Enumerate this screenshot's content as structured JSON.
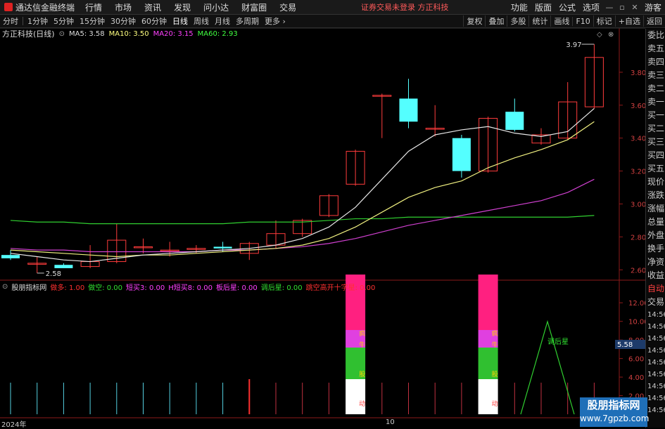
{
  "menu": {
    "app_title": "通达信金融终端",
    "items": [
      "行情",
      "市场",
      "资讯",
      "发现",
      "问小达",
      "财富圈",
      "交易"
    ],
    "notice": "证券交易未登录  方正科技",
    "right_items": [
      "功能",
      "版面",
      "公式",
      "选项"
    ],
    "guest": "游客"
  },
  "periods": [
    "分时",
    "1分钟",
    "5分钟",
    "15分钟",
    "30分钟",
    "60分钟",
    "日线",
    "周线",
    "月线",
    "多周期",
    "更多"
  ],
  "active_period": "日线",
  "toolbar": [
    "复权",
    "叠加",
    "多股",
    "统计",
    "画线",
    "F10",
    "标记",
    "+自选",
    "返回"
  ],
  "stock": {
    "name": "方正科技(日线)",
    "ma5": "MA5: 3.58",
    "ma10": "MA10: 3.50",
    "ma20": "MA20: 3.15",
    "ma60": "MA60: 2.93"
  },
  "price_axis": [
    "3.80",
    "3.60",
    "3.40",
    "3.20",
    "3.00",
    "2.80",
    "2.60"
  ],
  "price_labels": {
    "high": "3.97",
    "low": "2.58"
  },
  "indicator": {
    "name": "股朋指标网",
    "items": [
      {
        "label": "做多: 1.00",
        "color": "#ff3030"
      },
      {
        "label": "做空: 0.00",
        "color": "#30e030"
      },
      {
        "label": "短买3: 0.00",
        "color": "#ff40ff"
      },
      {
        "label": "H短买8: 0.00",
        "color": "#ff40ff"
      },
      {
        "label": "板后星: 0.00",
        "color": "#ff40ff"
      },
      {
        "label": "调后星: 0.00",
        "color": "#30e030"
      },
      {
        "label": "跳空高开十字星: 0.00",
        "color": "#ff3030"
      }
    ],
    "axis": [
      "12.00",
      "10.00",
      "8.00",
      "6.00",
      "4.00",
      "2.00"
    ],
    "cursor_value": "5.58",
    "bar_labels": [
      "疯",
      "牛",
      "股",
      "动"
    ],
    "peak_label": "调后星"
  },
  "side_panel": [
    "委比",
    "卖五",
    "卖四",
    "卖三",
    "卖二",
    "卖一",
    "买一",
    "买二",
    "买三",
    "买四",
    "买五",
    "现价",
    "涨跌",
    "涨幅",
    "总量",
    "外盘",
    "换手",
    "净资",
    "收益"
  ],
  "side_lower": [
    "自动",
    "交易"
  ],
  "side_times": [
    "14:56",
    "14:56",
    "14:56",
    "14:56",
    "14:56",
    "14:56",
    "14:56",
    "14:56",
    "14:56"
  ],
  "bottom": {
    "year": "2024年",
    "month": "10"
  },
  "watermark": {
    "title": "股朋指标网",
    "url": "www.7gpzb.com"
  },
  "chart_data": {
    "type": "candlestick",
    "ylim": [
      2.55,
      4.0
    ],
    "candles": [
      {
        "o": 2.69,
        "c": 2.67,
        "h": 2.72,
        "l": 2.66
      },
      {
        "o": 2.64,
        "c": 2.64,
        "h": 2.68,
        "l": 2.58
      },
      {
        "o": 2.63,
        "c": 2.61,
        "h": 2.64,
        "l": 2.61
      },
      {
        "o": 2.62,
        "c": 2.65,
        "h": 2.75,
        "l": 2.61
      },
      {
        "o": 2.65,
        "c": 2.78,
        "h": 2.88,
        "l": 2.64
      },
      {
        "o": 2.74,
        "c": 2.74,
        "h": 2.79,
        "l": 2.7
      },
      {
        "o": 2.72,
        "c": 2.72,
        "h": 2.77,
        "l": 2.68
      },
      {
        "o": 2.73,
        "c": 2.73,
        "h": 2.75,
        "l": 2.7
      },
      {
        "o": 2.74,
        "c": 2.73,
        "h": 2.77,
        "l": 2.71
      },
      {
        "o": 2.7,
        "c": 2.76,
        "h": 2.77,
        "l": 2.66
      },
      {
        "o": 2.75,
        "c": 2.82,
        "h": 2.9,
        "l": 2.73
      },
      {
        "o": 2.82,
        "c": 2.9,
        "h": 2.91,
        "l": 2.8
      },
      {
        "o": 2.93,
        "c": 3.05,
        "h": 3.06,
        "l": 2.92
      },
      {
        "o": 3.12,
        "c": 3.32,
        "h": 3.33,
        "l": 3.11
      },
      {
        "o": 3.66,
        "c": 3.66,
        "h": 3.67,
        "l": 3.4
      },
      {
        "o": 3.64,
        "c": 3.5,
        "h": 3.76,
        "l": 3.46
      },
      {
        "o": 3.46,
        "c": 3.46,
        "h": 3.6,
        "l": 3.41
      },
      {
        "o": 3.4,
        "c": 3.2,
        "h": 3.42,
        "l": 3.16
      },
      {
        "o": 3.2,
        "c": 3.52,
        "h": 3.53,
        "l": 3.19
      },
      {
        "o": 3.56,
        "c": 3.45,
        "h": 3.64,
        "l": 3.44
      },
      {
        "o": 3.37,
        "c": 3.42,
        "h": 3.46,
        "l": 3.36
      },
      {
        "o": 3.4,
        "c": 3.62,
        "h": 3.74,
        "l": 3.39
      },
      {
        "o": 3.59,
        "c": 3.89,
        "h": 3.97,
        "l": 3.58
      }
    ],
    "ma5": [
      2.7,
      2.68,
      2.66,
      2.65,
      2.67,
      2.69,
      2.7,
      2.71,
      2.72,
      2.73,
      2.75,
      2.79,
      2.86,
      2.98,
      3.15,
      3.32,
      3.42,
      3.45,
      3.47,
      3.43,
      3.41,
      3.44,
      3.58
    ],
    "ma10": [
      2.72,
      2.71,
      2.7,
      2.69,
      2.68,
      2.69,
      2.69,
      2.7,
      2.71,
      2.72,
      2.73,
      2.75,
      2.79,
      2.86,
      2.95,
      3.04,
      3.1,
      3.14,
      3.22,
      3.28,
      3.33,
      3.39,
      3.5
    ],
    "ma20": [
      2.73,
      2.72,
      2.72,
      2.71,
      2.71,
      2.71,
      2.71,
      2.71,
      2.72,
      2.72,
      2.73,
      2.74,
      2.76,
      2.79,
      2.83,
      2.87,
      2.9,
      2.93,
      2.96,
      2.99,
      3.02,
      3.07,
      3.15
    ],
    "ma60": [
      2.9,
      2.89,
      2.89,
      2.88,
      2.88,
      2.88,
      2.88,
      2.88,
      2.88,
      2.89,
      2.89,
      2.89,
      2.9,
      2.91,
      2.91,
      2.92,
      2.92,
      2.92,
      2.92,
      2.92,
      2.92,
      2.92,
      2.93
    ]
  }
}
